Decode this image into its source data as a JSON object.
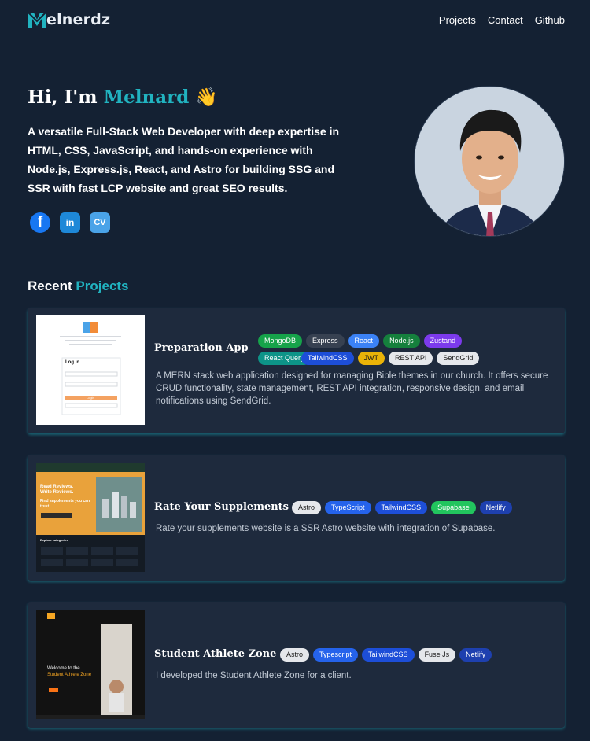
{
  "header": {
    "logo_text": "elnerdz",
    "nav": [
      {
        "label": "Projects"
      },
      {
        "label": "Contact"
      },
      {
        "label": "Github"
      }
    ]
  },
  "hero": {
    "greeting": "Hi, I'm ",
    "name": "Melnard",
    "wave": "👋",
    "description": "A versatile Full-Stack Web Developer with deep expertise in HTML, CSS, JavaScript, and hands-on experience with Node.js, Express.js, React, and Astro for building SSG and SSR with fast LCP website and great SEO results.",
    "social": [
      {
        "label": "f",
        "icon": "facebook-icon"
      },
      {
        "label": "in",
        "icon": "linkedin-icon"
      },
      {
        "label": "CV",
        "icon": "cv-icon"
      }
    ]
  },
  "projects_section": {
    "title_prefix": "Recent ",
    "title_accent": "Projects"
  },
  "projects": [
    {
      "title": "Preparation App",
      "tags": [
        {
          "label": "MongoDB",
          "color": "#16a34a"
        },
        {
          "label": "Express",
          "color": "#374151"
        },
        {
          "label": "React",
          "color": "#3b82f6"
        },
        {
          "label": "Node.js",
          "color": "#15803d"
        },
        {
          "label": "Zustand",
          "color": "#7c3aed"
        },
        {
          "label": "React Query",
          "color": "#0d9488"
        },
        {
          "label": "TailwindCSS",
          "color": "#1d4ed8"
        },
        {
          "label": "JWT",
          "color": "#eab308",
          "text": "#1a1a1a"
        },
        {
          "label": "REST API",
          "color": "#e5e7eb",
          "text": "#1a1a1a"
        },
        {
          "label": "SendGrid",
          "color": "#e5e7eb",
          "text": "#1a1a1a"
        }
      ],
      "description": "A MERN stack web application designed for managing Bible themes in our church. It offers secure CRUD functionality, state management, REST API integration, responsive design, and email notifications using SendGrid.",
      "thumb": {
        "login_heading": "Log in",
        "login_button": "Login"
      }
    },
    {
      "title": "Rate Your Supplements",
      "tags": [
        {
          "label": "Astro",
          "color": "#e5e7eb",
          "text": "#1a1a1a"
        },
        {
          "label": "TypeScript",
          "color": "#2563eb"
        },
        {
          "label": "TailwindCSS",
          "color": "#1d4ed8"
        },
        {
          "label": "Supabase",
          "color": "#22c55e"
        },
        {
          "label": "Netlify",
          "color": "#1e40af"
        }
      ],
      "description": "Rate your supplements website is a SSR Astro website with integration of Supabase.",
      "thumb": {
        "headline_1": "Read Reviews.",
        "headline_2": "Write Reviews.",
        "headline_3": "Find supplements you can trust.",
        "categories_label": "Explore categories"
      }
    },
    {
      "title": "Student Athlete Zone",
      "tags": [
        {
          "label": "Astro",
          "color": "#e5e7eb",
          "text": "#1a1a1a"
        },
        {
          "label": "Typescript",
          "color": "#2563eb"
        },
        {
          "label": "TailwindCSS",
          "color": "#1d4ed8"
        },
        {
          "label": "Fuse Js",
          "color": "#e5e7eb",
          "text": "#1a1a1a"
        },
        {
          "label": "Netlify",
          "color": "#1e40af"
        }
      ],
      "description": "I developed the Student Athlete Zone for a client.",
      "thumb": {
        "welcome_1": "Welcome to the",
        "welcome_2": "Student Athlete Zone"
      }
    }
  ]
}
